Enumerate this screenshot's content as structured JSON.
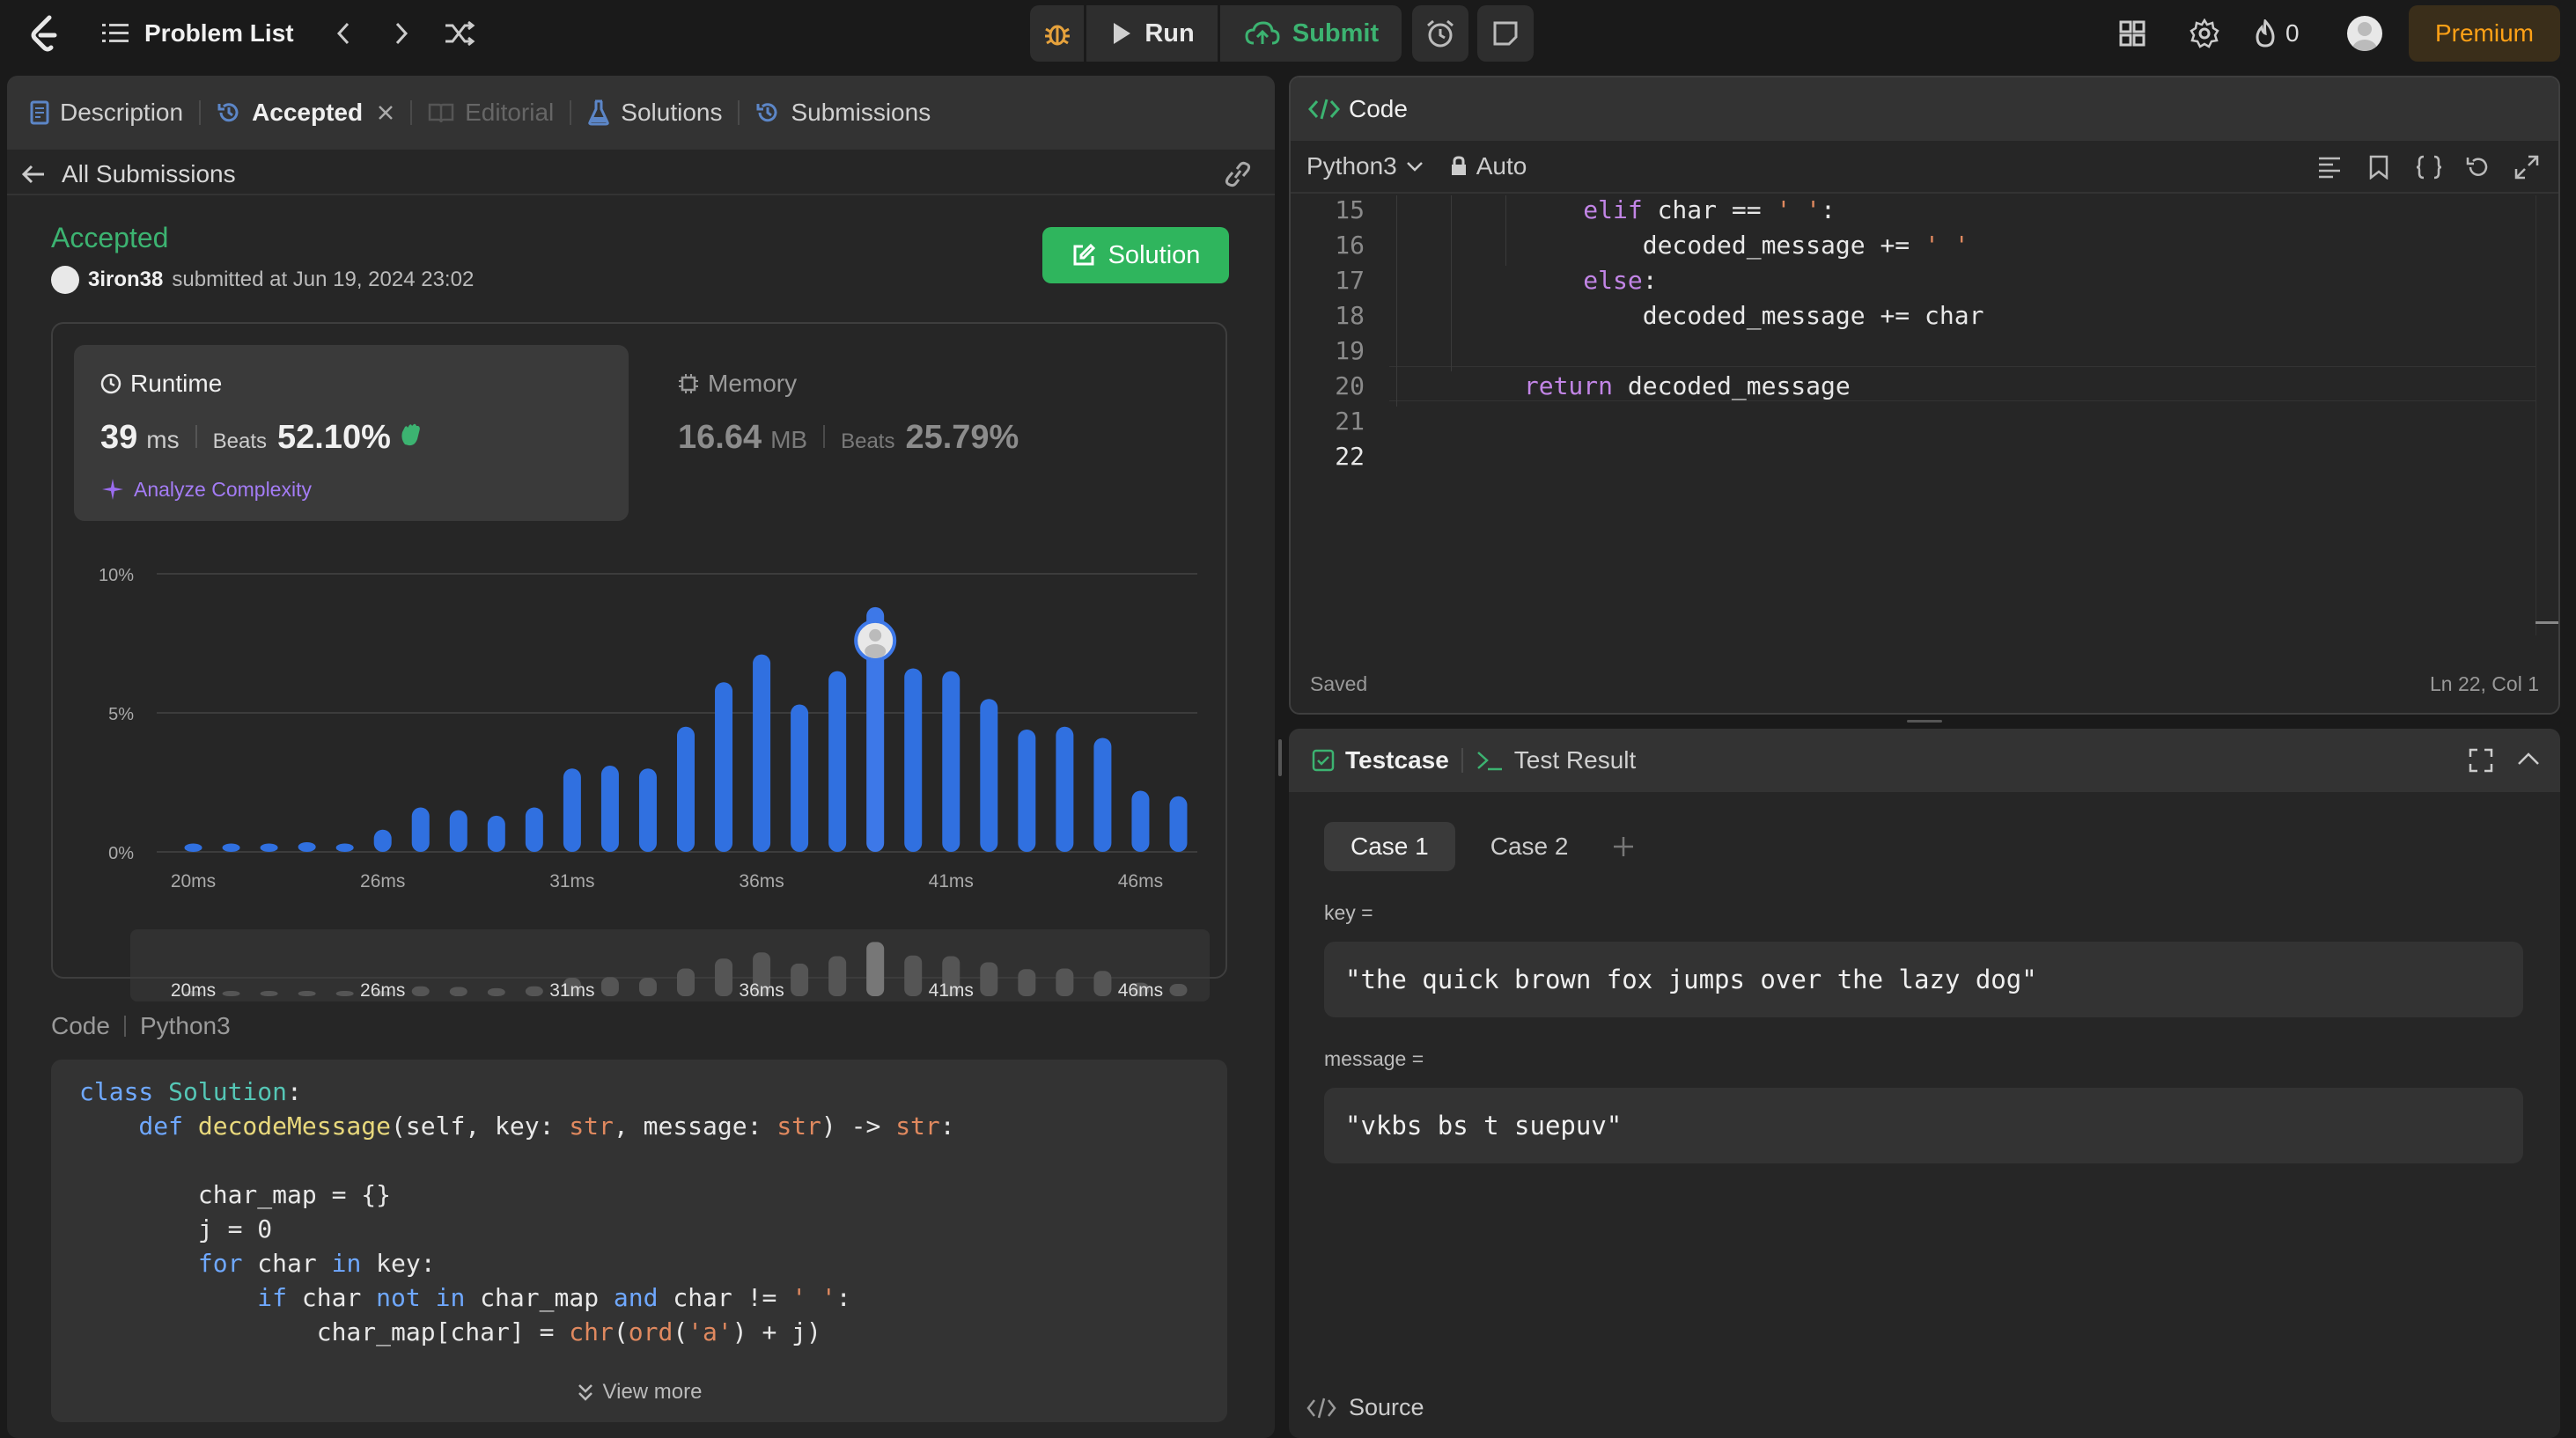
{
  "topbar": {
    "problem_list_label": "Problem List",
    "run_label": "Run",
    "submit_label": "Submit",
    "streak_count": "0",
    "premium_label": "Premium"
  },
  "left_tabs": {
    "description": "Description",
    "accepted": "Accepted",
    "editorial": "Editorial",
    "solutions": "Solutions",
    "submissions": "Submissions"
  },
  "submission": {
    "back_label": "All Submissions",
    "status": "Accepted",
    "username": "3iron38",
    "submitted_text": "submitted at Jun 19, 2024 23:02",
    "solution_button": "Solution",
    "runtime_label": "Runtime",
    "runtime_value": "39",
    "runtime_unit": "ms",
    "beats_label": "Beats",
    "runtime_beats": "52.10%",
    "analyze_label": "Analyze Complexity",
    "memory_label": "Memory",
    "memory_value": "16.64",
    "memory_unit": "MB",
    "memory_beats_label": "Beats",
    "memory_beats": "25.79%"
  },
  "chart_data": {
    "type": "bar",
    "title": "",
    "y_ticks": [
      "10%",
      "5%",
      "0%"
    ],
    "x_ticks": [
      "20ms",
      "26ms",
      "31ms",
      "36ms",
      "41ms",
      "46ms"
    ],
    "ylim": [
      0,
      10
    ],
    "highlighted_index": 18,
    "highlighted_value_label": "39ms",
    "values": [
      0.3,
      0.3,
      0.3,
      0.35,
      0.3,
      0.8,
      1.6,
      1.5,
      1.3,
      1.6,
      3.0,
      3.1,
      3.0,
      4.5,
      6.1,
      7.1,
      5.3,
      6.5,
      8.8,
      6.6,
      6.5,
      5.5,
      4.4,
      4.5,
      4.1,
      2.2,
      2.0
    ],
    "grid": true,
    "legend": "none"
  },
  "code_section": {
    "label": "Code",
    "language": "Python3",
    "view_more": "View more",
    "lines": [
      [
        [
          "class ",
          "kw"
        ],
        [
          "Solution",
          "cl"
        ],
        [
          ":",
          ""
        ]
      ],
      [
        [
          "    def ",
          "kw"
        ],
        [
          "decodeMessage",
          "fn"
        ],
        [
          "(self, key: ",
          ""
        ],
        [
          "str",
          "ty"
        ],
        [
          ", message: ",
          ""
        ],
        [
          "str",
          "ty"
        ],
        [
          ") -> ",
          ""
        ],
        [
          "str",
          "ty"
        ],
        [
          ":",
          ""
        ]
      ],
      [
        [
          "",
          ""
        ]
      ],
      [
        [
          "        char_map = {}",
          ""
        ]
      ],
      [
        [
          "        j = 0",
          ""
        ]
      ],
      [
        [
          "        for ",
          "kw"
        ],
        [
          "char ",
          ""
        ],
        [
          "in ",
          "kw"
        ],
        [
          "key:",
          ""
        ]
      ],
      [
        [
          "            if ",
          "kw"
        ],
        [
          "char ",
          ""
        ],
        [
          "not in ",
          "kw"
        ],
        [
          "char_map ",
          ""
        ],
        [
          "and ",
          "kw"
        ],
        [
          "char != ",
          ""
        ],
        [
          "' '",
          "st"
        ],
        [
          ":",
          ""
        ]
      ],
      [
        [
          "                char_map[char] = ",
          ""
        ],
        [
          "chr",
          "ty"
        ],
        [
          "(",
          ""
        ],
        [
          "ord",
          "ty"
        ],
        [
          "(",
          ""
        ],
        [
          "'a'",
          "st"
        ],
        [
          ") + j)",
          ""
        ]
      ]
    ]
  },
  "editor": {
    "title": "Code",
    "language": "Python3",
    "mode": "Auto",
    "saved_label": "Saved",
    "cursor_pos": "Ln 22, Col 1",
    "line_numbers": [
      "15",
      "16",
      "17",
      "18",
      "19",
      "20",
      "21",
      "22"
    ],
    "lines": [
      [
        [
          "            elif ",
          "kw2"
        ],
        [
          "char == ",
          ""
        ],
        [
          "' '",
          "st"
        ],
        [
          ":",
          ""
        ]
      ],
      [
        [
          "                decoded_message += ",
          ""
        ],
        [
          "' '",
          "st"
        ]
      ],
      [
        [
          "            else",
          "kw2"
        ],
        [
          ":",
          ""
        ]
      ],
      [
        [
          "                decoded_message += char",
          ""
        ]
      ],
      [
        [
          "",
          ""
        ]
      ],
      [
        [
          "        return ",
          "kw2"
        ],
        [
          "decoded_message",
          ""
        ]
      ],
      [
        [
          "",
          ""
        ]
      ],
      [
        [
          "",
          ""
        ]
      ]
    ]
  },
  "testcase": {
    "tab_label": "Testcase",
    "result_label": "Test Result",
    "case1": "Case 1",
    "case2": "Case 2",
    "key_label": "key =",
    "key_value": "\"the quick brown fox jumps over the lazy dog\"",
    "message_label": "message =",
    "message_value": "\"vkbs bs t suepuv\"",
    "source_label": "Source"
  }
}
